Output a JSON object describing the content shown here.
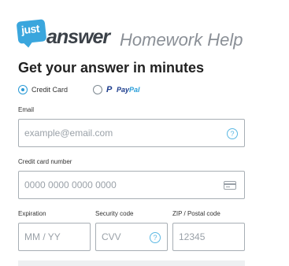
{
  "brand": {
    "badge": "just",
    "name": "answer",
    "suffix": "Homework Help"
  },
  "title": "Get your answer in minutes",
  "payment_methods": [
    {
      "label": "Credit Card",
      "selected": true
    },
    {
      "label_pay": "Pay",
      "label_pal": "Pal",
      "icon": "P",
      "selected": false
    }
  ],
  "form": {
    "email": {
      "label": "Email",
      "placeholder": "example@email.com",
      "help": "?"
    },
    "card_number": {
      "label": "Credit card number",
      "placeholder": "0000 0000 0000 0000"
    },
    "expiration": {
      "label": "Expiration",
      "placeholder": "MM / YY"
    },
    "security": {
      "label": "Security code",
      "placeholder": "CVV",
      "help": "?"
    },
    "zip": {
      "label": "ZIP / Postal code",
      "placeholder": "12345"
    }
  },
  "colors": {
    "accent": "#2a9ad6",
    "brand_badge": "#3aa6dd",
    "paypal_dark": "#1b3b8c",
    "paypal_light": "#2b9fd9"
  }
}
